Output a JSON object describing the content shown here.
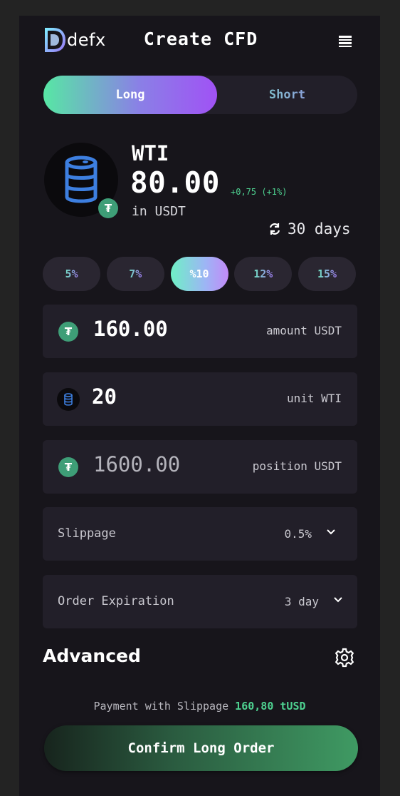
{
  "header": {
    "brand": "defx",
    "title": "Create CFD"
  },
  "side_toggle": {
    "long": "Long",
    "short": "Short",
    "selected": "Long"
  },
  "asset": {
    "symbol": "WTI",
    "price": "80.00",
    "change": "+0,75 (+1%)",
    "quote": "in USDT",
    "icon": "oil-barrel-icon",
    "badge_icon": "tether-icon",
    "duration": "30 days"
  },
  "leverage": {
    "options": [
      "5%",
      "7%",
      "%10",
      "12%",
      "15%"
    ],
    "selected": "%10"
  },
  "amount": {
    "value": "160.00",
    "label": "amount USDT"
  },
  "unit": {
    "value": "20",
    "label": "unit WTI"
  },
  "position": {
    "value": "1600.00",
    "label": "position USDT"
  },
  "slippage": {
    "label": "Slippage",
    "value": "0.5%"
  },
  "expiration": {
    "label": "Order Expiration",
    "value": "3 day"
  },
  "advanced": {
    "label": "Advanced"
  },
  "payment": {
    "prefix": "Payment with Slippage",
    "amount": "160,80 tUSD"
  },
  "confirm_label": "Confirm Long Order",
  "colors": {
    "background": "#17151b",
    "card": "#221f29",
    "accent_green": "#4ed291",
    "tether": "#3e9e77",
    "gradient_start": "#57e7a4",
    "gradient_end": "#a052f5"
  }
}
